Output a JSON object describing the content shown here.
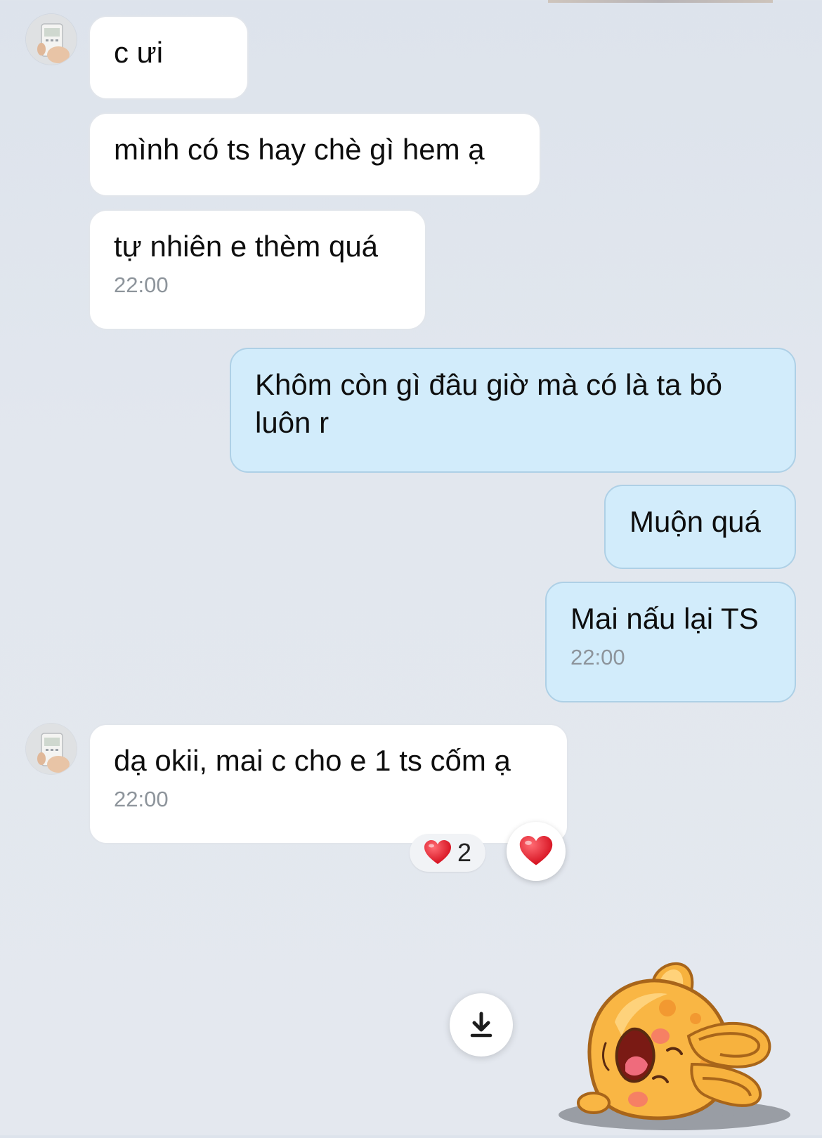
{
  "messages": [
    {
      "id": "m1",
      "direction": "in",
      "text": "c ưi",
      "time": ""
    },
    {
      "id": "m2",
      "direction": "in",
      "text": "mình có ts hay chè gì hem ạ",
      "time": ""
    },
    {
      "id": "m3",
      "direction": "in",
      "text": "tự nhiên e thèm quá",
      "time": "22:00"
    },
    {
      "id": "m4",
      "direction": "out",
      "text": "Khôm còn gì đâu giờ mà có là ta bỏ\nluôn r",
      "time": ""
    },
    {
      "id": "m5",
      "direction": "out",
      "text": "Muộn quá",
      "time": ""
    },
    {
      "id": "m6",
      "direction": "out",
      "text": "Mai nấu lại TS",
      "time": "22:00"
    },
    {
      "id": "m7",
      "direction": "in",
      "text": "dạ okii, mai c cho e 1 ts cốm ạ",
      "time": "22:00"
    }
  ],
  "reaction": {
    "emoji": "heart-icon",
    "count": "2"
  },
  "colors": {
    "background": "#e2e7ee",
    "incoming_bubble": "#ffffff",
    "outgoing_bubble": "#d2ecfb",
    "outgoing_border": "#aed0e6",
    "timestamp": "#8d949b",
    "heart": "#e8202e"
  },
  "icons": {
    "scroll_down": "download-arrow-icon",
    "sticker": "crying-bunny-sticker"
  }
}
